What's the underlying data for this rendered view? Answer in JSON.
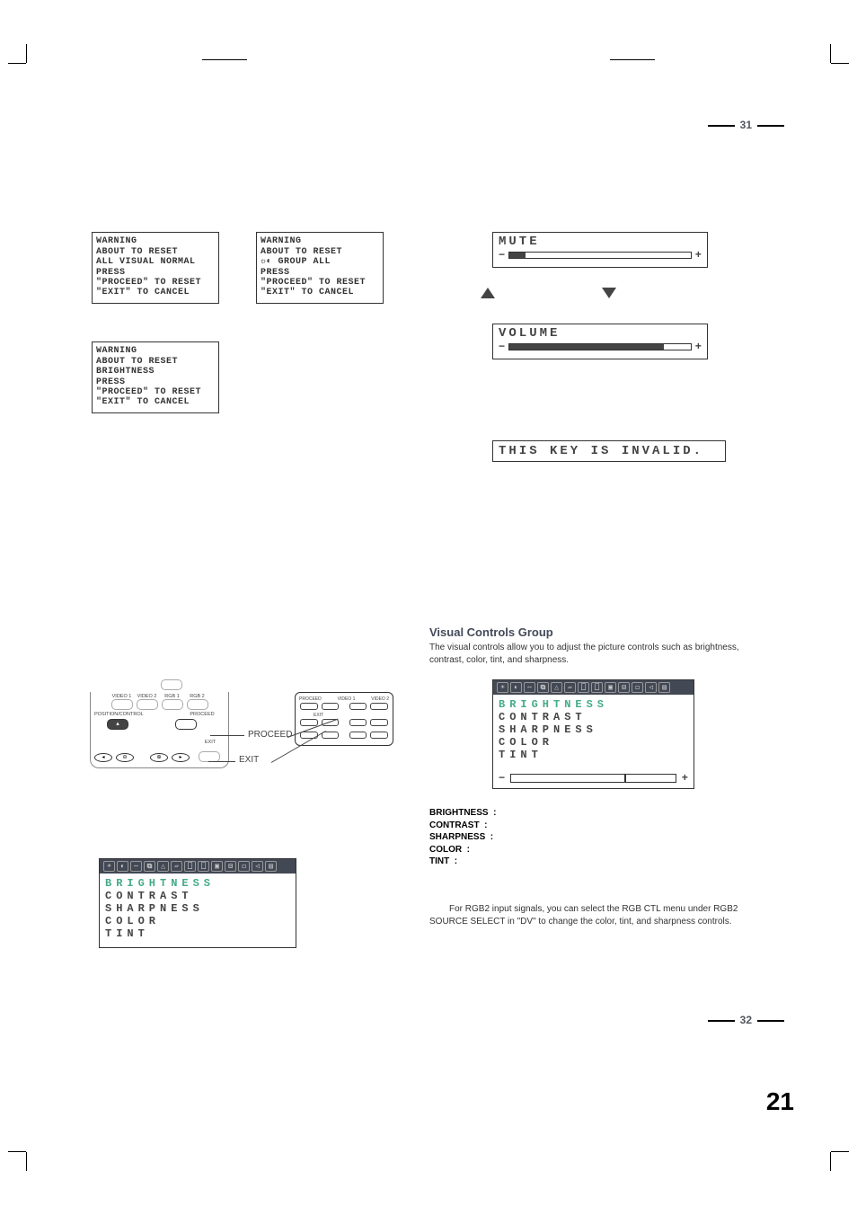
{
  "page_numbers": {
    "p31": "31",
    "p32": "32",
    "main": "21"
  },
  "warnings": {
    "w1": {
      "hdr": "WARNING",
      "l1": "ABOUT TO RESET",
      "l2": "ALL VISUAL NORMAL",
      "l3": "PRESS",
      "l4": "\"PROCEED\" TO RESET",
      "l5": "\"EXIT\" TO CANCEL"
    },
    "w2": {
      "hdr": "WARNING",
      "l1": "ABOUT TO RESET",
      "l2": "BRIGHTNESS",
      "l3": "PRESS",
      "l4": "\"PROCEED\" TO RESET",
      "l5": "\"EXIT\" TO CANCEL"
    },
    "w3": {
      "hdr": "WARNING",
      "l1": "ABOUT TO RESET",
      "l2": "☼◐ GROUP ALL",
      "l3": "PRESS",
      "l4": "\"PROCEED\" TO RESET",
      "l5": "\"EXIT\" TO CANCEL"
    }
  },
  "sliders": {
    "mute": {
      "title": "MUTE",
      "minus": "−",
      "plus": "+"
    },
    "volume": {
      "title": "VOLUME",
      "minus": "−",
      "plus": "+"
    }
  },
  "invalid": "THIS KEY IS INVALID.",
  "remote": {
    "labels": {
      "v1": "VIDEO 1",
      "v2": "VIDEO 2",
      "r1": "RGB 1",
      "r2": "RGB 2",
      "pc": "POSITION/CONTROL",
      "pr": "PROCEED",
      "ex": "EXIT"
    },
    "symbols": {
      "left": "◂",
      "right": "▸",
      "minus": "⊖",
      "plus": "⊕",
      "up": "▴"
    }
  },
  "leaders": {
    "proceed": "PROCEED",
    "exit": "EXIT"
  },
  "compact": {
    "labels": {
      "pr": "PROCEED",
      "ex": "EXIT",
      "v1": "VIDEO 1",
      "v2": "VIDEO 2"
    }
  },
  "osd": {
    "items": {
      "brightness": "BRIGHTNESS",
      "contrast": "CONTRAST",
      "sharpness": "SHARPNESS",
      "color": "COLOR",
      "tint": "TINT"
    },
    "minus": "−",
    "plus": "+"
  },
  "label_list": {
    "brightness": "BRIGHTNESS",
    "contrast": "CONTRAST",
    "sharpness": "SHARPNESS",
    "color": "COLOR",
    "tint": "TINT"
  },
  "section": {
    "title": "Visual Controls Group",
    "body": "The visual controls allow you to adjust the picture controls such as brightness, contrast, color, tint, and sharpness."
  },
  "note": "For RGB2 input signals, you can select the RGB CTL menu under RGB2 SOURCE SELECT in \"DV\" to change the color, tint, and sharpness controls."
}
